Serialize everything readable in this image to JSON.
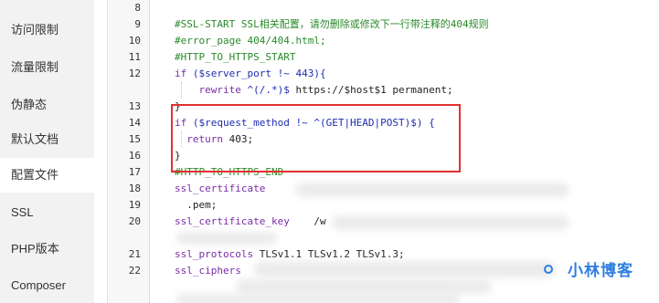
{
  "sidebar": {
    "items": [
      {
        "label": "访问限制"
      },
      {
        "label": "流量限制"
      },
      {
        "label": "伪静态"
      },
      {
        "label": "默认文档"
      },
      {
        "label": "配置文件",
        "active": true
      },
      {
        "label": "SSL"
      },
      {
        "label": "PHP版本"
      },
      {
        "label": "Composer"
      }
    ]
  },
  "editor": {
    "lines": [
      {
        "no": "8",
        "parts": []
      },
      {
        "no": "9",
        "parts": [
          {
            "t": "#SSL-START SSL相关配置，请勿删除或修改下一行带注释的404规则",
            "c": "comment"
          }
        ]
      },
      {
        "no": "10",
        "parts": [
          {
            "t": "#error_page 404/404.html;",
            "c": "comment"
          }
        ]
      },
      {
        "no": "11",
        "parts": [
          {
            "t": "#HTTP_TO_HTTPS_START",
            "c": "comment"
          }
        ]
      },
      {
        "no": "12",
        "parts": [
          {
            "t": "if ",
            "c": "kw"
          },
          {
            "t": "($server_port !~ 443){",
            "c": "var"
          }
        ]
      },
      {
        "no": "",
        "parts": [
          {
            "t": "    rewrite ",
            "c": "kw"
          },
          {
            "t": "^(/.*)$ ",
            "c": "var"
          },
          {
            "t": "https://$host$1 permanent;",
            "c": "plain"
          }
        ]
      },
      {
        "no": "13",
        "parts": [
          {
            "t": "}",
            "c": "plain"
          }
        ]
      },
      {
        "no": "14",
        "parts": [
          {
            "t": "if ",
            "c": "kw"
          },
          {
            "t": "($request_method !~ ^(GET|HEAD|POST)$) {",
            "c": "var"
          }
        ]
      },
      {
        "no": "15",
        "parts": [
          {
            "t": "  return ",
            "c": "kw"
          },
          {
            "t": "403;",
            "c": "plain"
          }
        ]
      },
      {
        "no": "16",
        "parts": [
          {
            "t": "}",
            "c": "plain"
          }
        ]
      },
      {
        "no": "17",
        "parts": [
          {
            "t": "#HTTP_TO_HTTPS_END",
            "c": "comment"
          }
        ]
      },
      {
        "no": "18",
        "parts": [
          {
            "t": "ssl_certificate",
            "c": "kw"
          }
        ]
      },
      {
        "no": "19",
        "parts": [
          {
            "t": "  .pem;",
            "c": "plain"
          }
        ]
      },
      {
        "no": "20",
        "parts": [
          {
            "t": "ssl_certificate_key",
            "c": "kw"
          },
          {
            "t": "    /w",
            "c": "plain"
          }
        ]
      },
      {
        "no": "",
        "parts": []
      },
      {
        "no": "21",
        "parts": [
          {
            "t": "ssl_protocols ",
            "c": "kw"
          },
          {
            "t": "TLSv1.1 TLSv1.2 TLSv1.3;",
            "c": "plain"
          }
        ]
      },
      {
        "no": "22",
        "parts": [
          {
            "t": "ssl_ciphers",
            "c": "kw"
          }
        ]
      }
    ]
  },
  "watermark": "小林博客"
}
